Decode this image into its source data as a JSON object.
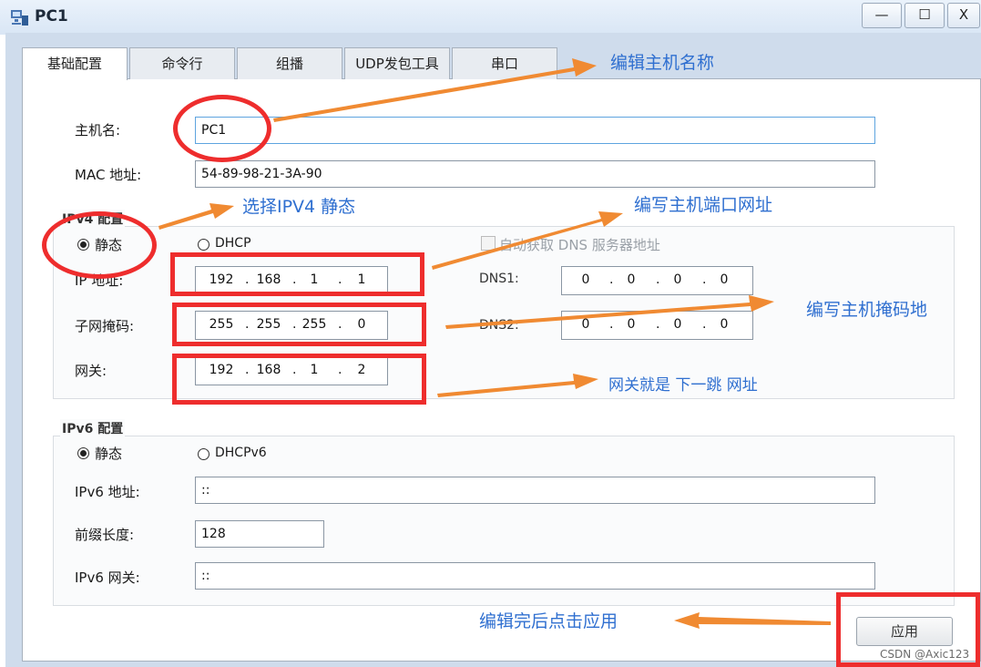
{
  "window": {
    "title": "PC1",
    "minimize": "—",
    "maximize": "☐",
    "close": "X"
  },
  "tabs": [
    "基础配置",
    "命令行",
    "组播",
    "UDP发包工具",
    "串口"
  ],
  "host": {
    "hostname_label": "主机名:",
    "hostname_value": "PC1",
    "mac_label": "MAC 地址:",
    "mac_value": "54-89-98-21-3A-90"
  },
  "ipv4": {
    "group_label": "IPv4 配置",
    "static_label": "静态",
    "dhcp_label": "DHCP",
    "auto_dns_label": "自动获取 DNS 服务器地址",
    "ip_label": "IP 地址:",
    "ip": [
      "192",
      "168",
      "1",
      "1"
    ],
    "mask_label": "子网掩码:",
    "mask": [
      "255",
      "255",
      "255",
      "0"
    ],
    "gateway_label": "网关:",
    "gateway": [
      "192",
      "168",
      "1",
      "2"
    ],
    "dns1_label": "DNS1:",
    "dns1": [
      "0",
      "0",
      "0",
      "0"
    ],
    "dns2_label": "DNS2:",
    "dns2": [
      "0",
      "0",
      "0",
      "0"
    ]
  },
  "ipv6": {
    "group_label": "IPv6 配置",
    "static_label": "静态",
    "dhcp_label": "DHCPv6",
    "addr_label": "IPv6 地址:",
    "addr_value": "::",
    "prefix_label": "前缀长度:",
    "prefix_value": "128",
    "gateway_label": "IPv6 网关:",
    "gateway_value": "::"
  },
  "apply_label": "应用",
  "annotations": {
    "edit_hostname": "编辑主机名称",
    "select_ipv4_static": "选择IPV4 静态",
    "write_host_ip": "编写主机端口网址",
    "write_mask": "编写主机掩码地",
    "gateway_note": "网关就是 下一跳 网址",
    "apply_note": "编辑完后点击应用"
  },
  "watermark": "CSDN @Axic123",
  "colors": {
    "annotation_text": "#2f6fd0",
    "arrow": "#f08a32",
    "highlight": "#ee2d2d"
  }
}
